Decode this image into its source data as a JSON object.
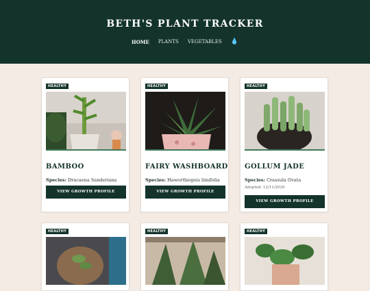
{
  "header": {
    "title": "BETH'S PLANT TRACKER",
    "nav": [
      "HOME",
      "PLANTS",
      "VEGETABLES"
    ],
    "water_icon": "water-drop-icon"
  },
  "plants": [
    {
      "status": "HEALTHY",
      "name": "BAMBOO",
      "species_label": "Species:",
      "species": "Dracaena Sanderiana",
      "button": "VIEW GROWTH PROFILE"
    },
    {
      "status": "HEALTHY",
      "name": "FAIRY WASHBOARD",
      "species_label": "Species:",
      "species": "Haworthiopsis limifolia",
      "button": "VIEW GROWTH PROFILE"
    },
    {
      "status": "HEALTHY",
      "name": "GOLLUM JADE",
      "species_label": "Species:",
      "species": "Crassula Ovata",
      "adopted": "Adopted: 12/11/2020",
      "button": "VIEW GROWTH PROFILE"
    },
    {
      "status": "HEALTHY"
    },
    {
      "status": "HEALTHY"
    },
    {
      "status": "HEALTHY"
    }
  ]
}
